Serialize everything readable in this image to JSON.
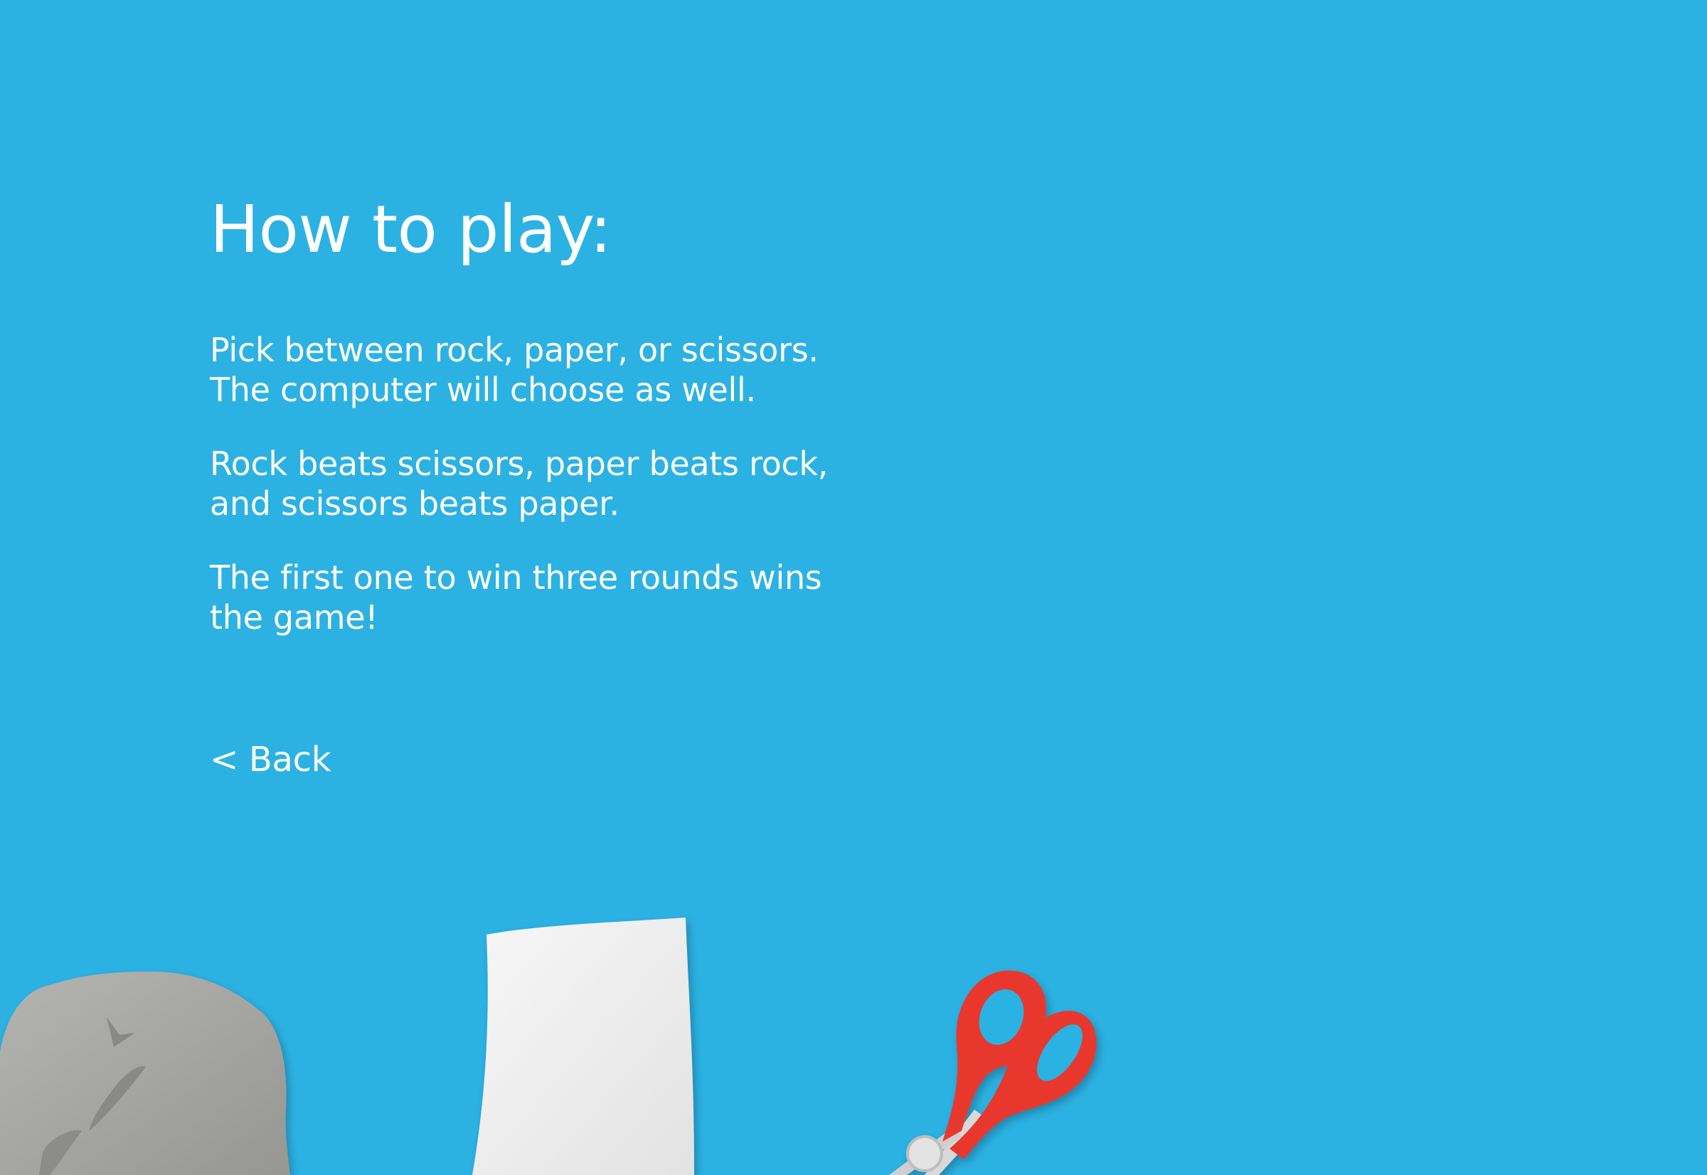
{
  "page": {
    "background_color": "#2bb2e3",
    "title": "How to play:",
    "paragraphs": [
      "Pick between rock, paper, or scissors. The computer will choose as well.",
      "Rock beats scissors, paper beats rock, and scissors beats paper.",
      "The first one to win three rounds wins the game!"
    ],
    "back_label": "< Back"
  },
  "decorations": {
    "items": [
      "rock-icon",
      "paper-icon",
      "scissors-icon"
    ],
    "scissors_color": "#e8372f",
    "rock_color": "#a3a3a0",
    "paper_color": "#ededed"
  }
}
